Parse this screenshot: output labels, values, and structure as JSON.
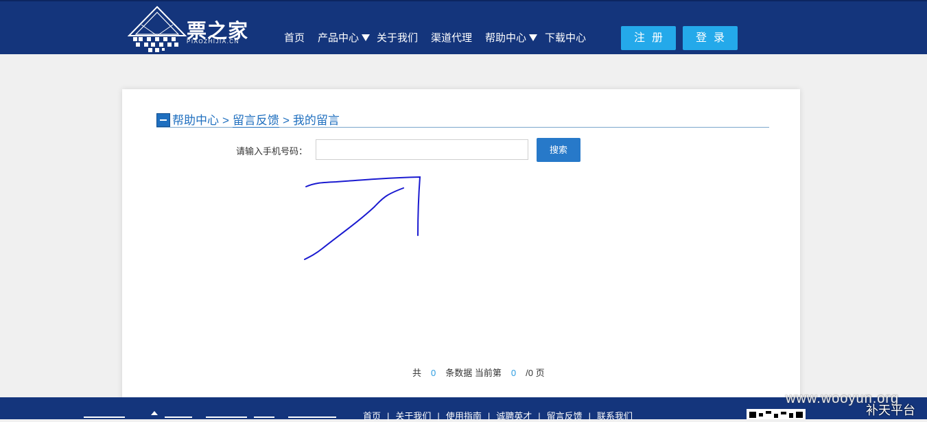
{
  "header": {
    "logo_text": "票之家",
    "logo_sub": "PIAOZHIJIA.CN",
    "nav": [
      {
        "label": "首页"
      },
      {
        "label": "产品中心"
      },
      {
        "label": "关于我们"
      },
      {
        "label": "渠道代理"
      },
      {
        "label": "帮助中心"
      },
      {
        "label": "下载中心"
      }
    ],
    "register_label": "注册",
    "login_label": "登录"
  },
  "breadcrumb": {
    "item1": "帮助中心",
    "item2": "留言反馈",
    "item3": "我的留言",
    "separator": ">"
  },
  "search": {
    "label": "请输入手机号码：",
    "value": "",
    "placeholder": "",
    "button_label": "搜索"
  },
  "pager": {
    "prefix": "共",
    "total": "0",
    "middle": "条数据 当前第",
    "current": "0",
    "suffix": "/0 页"
  },
  "footer": {
    "links": [
      "首页",
      "关于我们",
      "使用指南",
      "诚聘英才",
      "留言反馈",
      "联系我们"
    ]
  },
  "watermark": {
    "site": "www.wooyun.org",
    "platform": "补天平台"
  },
  "colors": {
    "header_bg": "#14357c",
    "button_bg": "#24a9ea",
    "link_blue": "#1f6fbf",
    "annotation": "#1a1ad0"
  },
  "icons": [
    "logo-mountain-icon",
    "dropdown-triangle-icon",
    "minus-square-icon",
    "qr-code-icon"
  ]
}
